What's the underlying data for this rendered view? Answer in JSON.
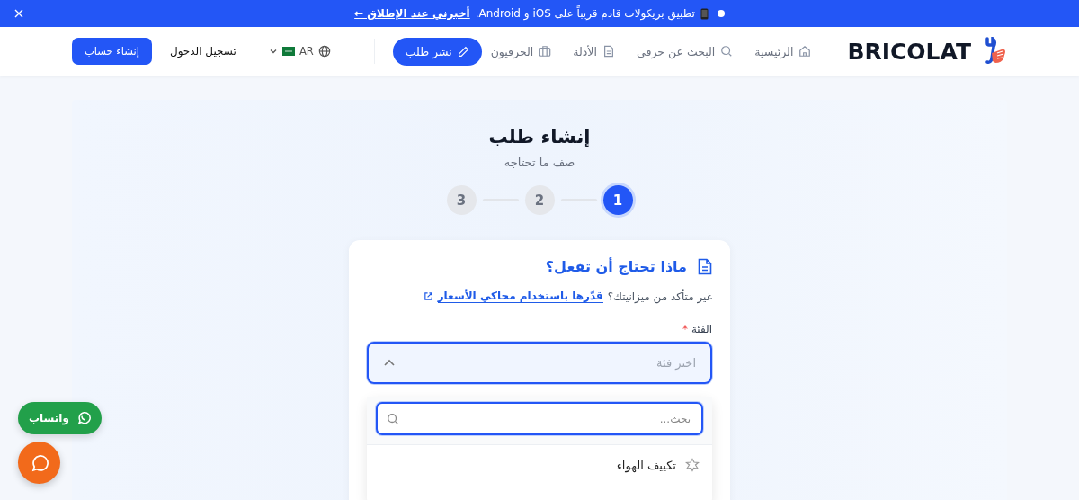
{
  "banner": {
    "text": "تطبيق بريكولات قادم قريباً على iOS و Android.",
    "link": "أخبرني عند الإطلاق ←"
  },
  "header": {
    "logo": "BRICOLAT",
    "nav": [
      {
        "label": "الرئيسية"
      },
      {
        "label": "البحث عن حرفي"
      },
      {
        "label": "الأدلة"
      },
      {
        "label": "الحرفيون"
      }
    ],
    "post_button": "نشر طلب",
    "language": "AR",
    "login": "تسجيل الدخول",
    "signup": "إنشاء حساب"
  },
  "page": {
    "title": "إنشاء طلب",
    "subtitle": "صف ما تحتاجه",
    "steps": [
      {
        "label": "1",
        "selected": true
      },
      {
        "label": "2",
        "selected": false
      },
      {
        "label": "3",
        "selected": false
      }
    ]
  },
  "form": {
    "title": "ماذا تحتاج أن تفعل؟",
    "hint": "غير متأكد من ميزانيتك؟",
    "hint_link": "قدّرها باستخدام محاكي الأسعار",
    "field_label": "الفئة",
    "required_mark": "*",
    "placeholder": "اختر فئة",
    "expanded": true,
    "dropdown": {
      "search_placeholder": "بحث...",
      "options": [
        {
          "label": "تكييف الهواء"
        }
      ]
    }
  },
  "floating": {
    "whatsapp": "واتساب"
  }
}
